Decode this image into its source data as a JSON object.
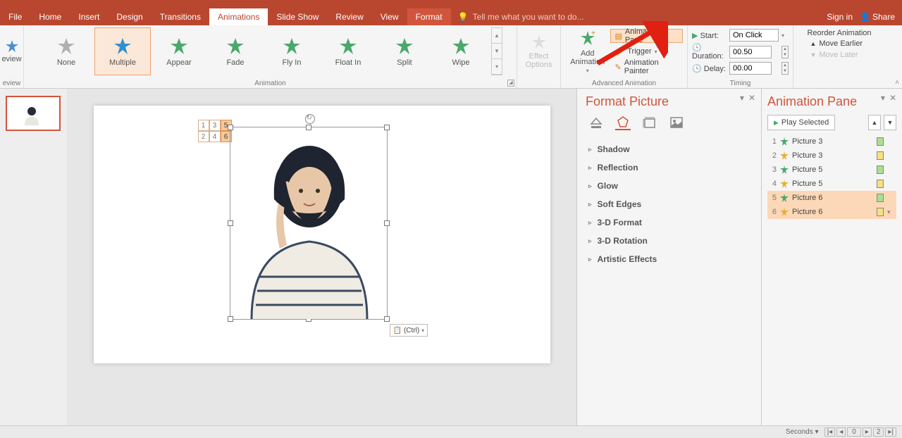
{
  "titlebar": {
    "signin": "Sign in",
    "share": "Share"
  },
  "tabs": [
    "File",
    "Home",
    "Insert",
    "Design",
    "Transitions",
    "Animations",
    "Slide Show",
    "Review",
    "View",
    "Format"
  ],
  "active_tab": "Animations",
  "tellme": "Tell me what you want to do...",
  "ribbon": {
    "preview_label": "eview",
    "preview_group": "eview",
    "gallery": [
      {
        "label": "None",
        "color": "#b0b0b0"
      },
      {
        "label": "Multiple",
        "color": "#2f8fd0"
      },
      {
        "label": "Appear",
        "color": "#4aa86c"
      },
      {
        "label": "Fade",
        "color": "#4aa86c"
      },
      {
        "label": "Fly In",
        "color": "#4aa86c"
      },
      {
        "label": "Float In",
        "color": "#4aa86c"
      },
      {
        "label": "Split",
        "color": "#4aa86c"
      },
      {
        "label": "Wipe",
        "color": "#4aa86c"
      }
    ],
    "gallery_selected": 1,
    "animation_group": "Animation",
    "effect_options": "Effect\nOptions",
    "add_animation": "Add\nAnimation",
    "anim_pane_btn": "Animation Pane",
    "trigger_btn": "Trigger",
    "painter_btn": "Animation Painter",
    "adv_group": "Advanced Animation",
    "start_label": "Start:",
    "start_value": "On Click",
    "duration_label": "Duration:",
    "duration_value": "00.50",
    "delay_label": "Delay:",
    "delay_value": "00.00",
    "timing_group": "Timing",
    "reorder_title": "Reorder Animation",
    "move_earlier": "Move Earlier",
    "move_later": "Move Later"
  },
  "slide_tags": {
    "c1": [
      "1",
      "2"
    ],
    "c2": [
      "3",
      "4"
    ],
    "c3": [
      "5",
      "6"
    ]
  },
  "ctrl_popup": "(Ctrl)",
  "format_picture": {
    "title": "Format Picture",
    "sections": [
      "Shadow",
      "Reflection",
      "Glow",
      "Soft Edges",
      "3-D Format",
      "3-D Rotation",
      "Artistic Effects"
    ]
  },
  "animation_pane": {
    "title": "Animation Pane",
    "play": "Play Selected",
    "items": [
      {
        "n": "1",
        "name": "Picture 3",
        "star": "#4aa86c",
        "bar": "g",
        "sel": false
      },
      {
        "n": "2",
        "name": "Picture 3",
        "star": "#e8b030",
        "bar": "y",
        "sel": false
      },
      {
        "n": "3",
        "name": "Picture 5",
        "star": "#4aa86c",
        "bar": "g",
        "sel": false
      },
      {
        "n": "4",
        "name": "Picture 5",
        "star": "#e8b030",
        "bar": "y",
        "sel": false
      },
      {
        "n": "5",
        "name": "Picture 6",
        "star": "#4aa86c",
        "bar": "g",
        "sel": true
      },
      {
        "n": "6",
        "name": "Picture 6",
        "star": "#e8b030",
        "bar": "y",
        "sel": true
      }
    ]
  },
  "statusbar": {
    "seconds": "Seconds",
    "timeline_val": "0",
    "zoom": "2"
  }
}
